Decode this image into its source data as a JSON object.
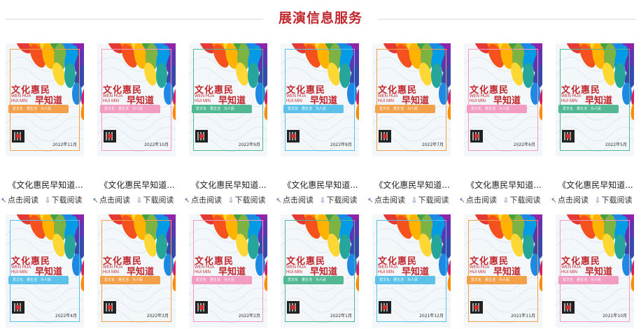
{
  "section_title": "展演信息服务",
  "cover": {
    "title_cn": "文化惠民",
    "title_en_1": "WEN HUA",
    "title_en_2": "HUI MIN",
    "title_suffix": "早知道",
    "tagline": "爱文化　惠生活　为人民"
  },
  "items": [
    {
      "caption": "《文化惠民早知道...",
      "read": "点击阅读",
      "download": "下载阅读",
      "date": "2022年11月",
      "accent": "#f2a14a"
    },
    {
      "caption": "《文化惠民早知道...",
      "read": "点击阅读",
      "download": "下载阅读",
      "date": "2022年10月",
      "accent": "#f19cc0"
    },
    {
      "caption": "《文化惠民早知道...",
      "read": "点击阅读",
      "download": "下载阅读",
      "date": "2022年9月",
      "accent": "#52b894"
    },
    {
      "caption": "《文化惠民早知道...",
      "read": "点击阅读",
      "download": "下载阅读",
      "date": "2022年8月",
      "accent": "#5bc1e8"
    },
    {
      "caption": "《文化惠民早知道...",
      "read": "点击阅读",
      "download": "下载阅读",
      "date": "2022年7月",
      "accent": "#f2a14a"
    },
    {
      "caption": "《文化惠民早知道...",
      "read": "点击阅读",
      "download": "下载阅读",
      "date": "2022年6月",
      "accent": "#f19cc0"
    },
    {
      "caption": "《文化惠民早知道...",
      "read": "点击阅读",
      "download": "下载阅读",
      "date": "2022年5月",
      "accent": "#52b894"
    },
    {
      "caption": "",
      "read": "",
      "download": "",
      "date": "2022年4月",
      "accent": "#5bc1e8"
    },
    {
      "caption": "",
      "read": "",
      "download": "",
      "date": "2022年3月",
      "accent": "#f2a14a"
    },
    {
      "caption": "",
      "read": "",
      "download": "",
      "date": "2022年2月",
      "accent": "#f19cc0"
    },
    {
      "caption": "",
      "read": "",
      "download": "",
      "date": "2022年1月",
      "accent": "#52b894"
    },
    {
      "caption": "",
      "read": "",
      "download": "",
      "date": "2021年12月",
      "accent": "#5bc1e8"
    },
    {
      "caption": "",
      "read": "",
      "download": "",
      "date": "2021年11月",
      "accent": "#f2a14a"
    },
    {
      "caption": "",
      "read": "",
      "download": "",
      "date": "2021年10月",
      "accent": "#f19cc0"
    }
  ],
  "icons": {
    "read": "cursor-icon",
    "download": "download-icon"
  },
  "colors": {
    "title": "#c0272d",
    "divider": "#d9d9d9"
  }
}
